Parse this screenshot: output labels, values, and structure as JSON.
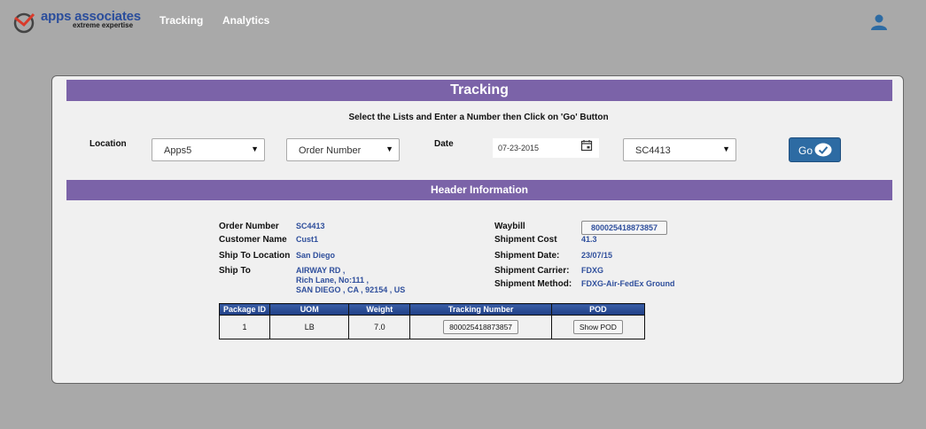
{
  "brand": {
    "name": "apps associates",
    "tagline": "extreme expertise"
  },
  "nav": {
    "tracking": "Tracking",
    "analytics": "Analytics"
  },
  "panel": {
    "title": "Tracking",
    "instruction": "Select the Lists and Enter a Number then Click on 'Go' Button"
  },
  "form": {
    "location_label": "Location",
    "location_value": "Apps5",
    "type_value": "Order Number",
    "date_label": "Date",
    "date_value": "07-23-2015",
    "order_value": "SC4413",
    "go_label": "Go"
  },
  "header_info": {
    "title": "Header Information",
    "order_number_label": "Order Number",
    "order_number": "SC4413",
    "customer_name_label": "Customer Name",
    "customer_name": "Cust1",
    "ship_to_location_label": "Ship To Location",
    "ship_to_location": "San Diego",
    "ship_to_label": "Ship To",
    "ship_to_line1": "AIRWAY RD ,",
    "ship_to_line2": "Rich Lane, No:111 ,",
    "ship_to_line3": "SAN DIEGO , CA , 92154 , US",
    "waybill_label": "Waybill",
    "waybill": "800025418873857",
    "shipment_cost_label": "Shipment Cost",
    "shipment_cost": "41.3",
    "shipment_date_label": "Shipment Date:",
    "shipment_date": "23/07/15",
    "shipment_carrier_label": "Shipment Carrier:",
    "shipment_carrier": "FDXG",
    "shipment_method_label": "Shipment Method:",
    "shipment_method": "FDXG-Air-FedEx Ground"
  },
  "packages": {
    "columns": [
      "Package ID",
      "UOM",
      "Weight",
      "Tracking Number",
      "POD"
    ],
    "rows": [
      {
        "package_id": "1",
        "uom": "LB",
        "weight": "7.0",
        "tracking_number": "800025418873857",
        "pod": "Show POD"
      }
    ]
  },
  "colors": {
    "accent_purple": "#7b63a8",
    "go_blue": "#2d6ba3",
    "value_blue": "#2f4f9c",
    "background": "#a9a9a9"
  }
}
